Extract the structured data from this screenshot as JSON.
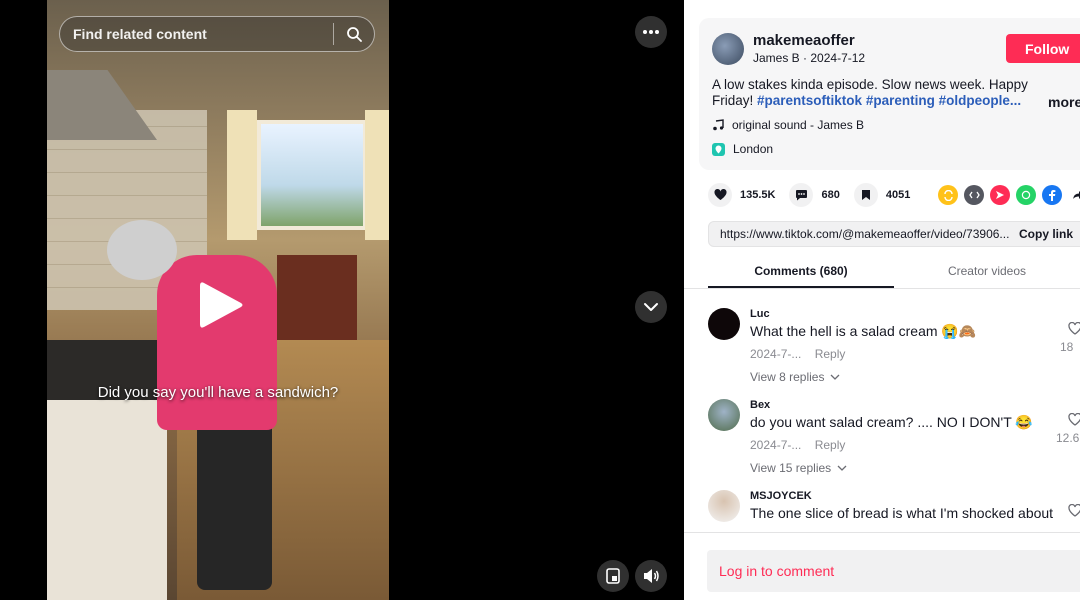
{
  "video": {
    "search_placeholder": "Find related content",
    "caption": "Did you say you'll have a sandwich?"
  },
  "author": {
    "username": "makemeaoffer",
    "nickname": "James B",
    "date": "2024-7-12",
    "follow_label": "Follow",
    "description_text": "A low stakes kinda episode. Slow news week. Happy Friday! ",
    "hashtags": [
      "#parentsoftiktok",
      "#parenting",
      "#oldpeople..."
    ],
    "more_label": "more",
    "sound": "original sound - James B",
    "location": "London"
  },
  "stats": {
    "likes": "135.5K",
    "comments": "680",
    "saves": "4051"
  },
  "link": {
    "url": "https://www.tiktok.com/@makemeaoffer/video/73906...",
    "copy_label": "Copy link"
  },
  "tabs": [
    {
      "label": "Comments (680)"
    },
    {
      "label": "Creator videos"
    }
  ],
  "comments": [
    {
      "user": "Luc",
      "text": "What the hell is a salad cream 😭🙈",
      "date": "2024-7-...",
      "reply": "Reply",
      "replies": "View 8 replies",
      "likes": "18"
    },
    {
      "user": "Bex",
      "text": "do you want salad cream? .... NO I DON'T 😂",
      "date": "2024-7-...",
      "reply": "Reply",
      "replies": "View 15 replies",
      "likes": "12.6"
    },
    {
      "user": "MSJOYCEK",
      "text": "The one slice of bread is what I'm shocked about",
      "date": "",
      "reply": "",
      "replies": "",
      "likes": ""
    }
  ],
  "login": {
    "label": "Log in to comment"
  },
  "colors": {
    "brand_red": "#fe2c55",
    "hashtag_blue": "#2b5db9"
  }
}
